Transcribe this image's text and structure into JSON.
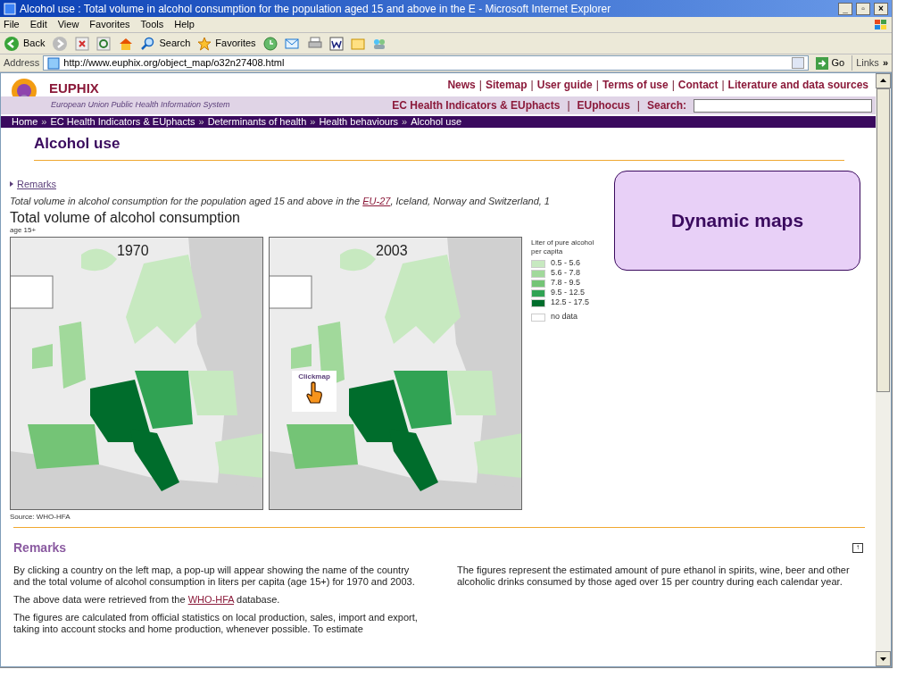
{
  "window": {
    "title": "Alcohol use : Total volume in alcohol consumption for the population aged 15 and above in the E - Microsoft Internet Explorer",
    "controls": [
      "_",
      "▫",
      "×"
    ]
  },
  "menu": [
    "File",
    "Edit",
    "View",
    "Favorites",
    "Tools",
    "Help"
  ],
  "toolbar": {
    "back": "Back",
    "search": "Search",
    "favorites": "Favorites"
  },
  "address_bar": {
    "label": "Address",
    "url": "http://www.euphix.org/object_map/o32n27408.html",
    "go": "Go",
    "links": "Links",
    "more": "»"
  },
  "site": {
    "name": "EUPHIX",
    "tagline": "European Union Public Health Information System",
    "top_links": [
      {
        "kind": "link",
        "text": "News"
      },
      {
        "kind": "separator",
        "text": "|"
      },
      {
        "kind": "link",
        "text": "Sitemap"
      },
      {
        "kind": "separator",
        "text": "|"
      },
      {
        "kind": "link",
        "text": "User guide"
      },
      {
        "kind": "separator",
        "text": "|"
      },
      {
        "kind": "link",
        "text": "Terms of use"
      },
      {
        "kind": "separator",
        "text": "|"
      },
      {
        "kind": "link",
        "text": "Contact"
      },
      {
        "kind": "separator",
        "text": "|"
      },
      {
        "kind": "link",
        "text": "Literature and data sources"
      }
    ],
    "nav_links": [
      {
        "kind": "link",
        "text": "EC Health Indicators & EUphacts"
      },
      {
        "kind": "separator",
        "text": "|"
      },
      {
        "kind": "link",
        "text": "EUphocus"
      },
      {
        "kind": "separator",
        "text": "|"
      }
    ],
    "search_label": "Search:",
    "breadcrumb": [
      {
        "kind": "link",
        "text": "Home"
      },
      {
        "kind": "separator",
        "text": "»"
      },
      {
        "kind": "link",
        "text": "EC Health Indicators & EUphacts"
      },
      {
        "kind": "separator",
        "text": "»"
      },
      {
        "kind": "link",
        "text": "Determinants of health"
      },
      {
        "kind": "separator",
        "text": "»"
      },
      {
        "kind": "link",
        "text": "Health behaviours"
      },
      {
        "kind": "separator",
        "text": "»"
      },
      {
        "kind": "link",
        "text": "Alcohol use"
      }
    ]
  },
  "page": {
    "title": "Alcohol use",
    "remarks_link": "Remarks",
    "intro_before": "Total volume in alcohol consumption for the population aged 15 and above in the ",
    "intro_link": "EU-27",
    "intro_after": ", Iceland, Norway and Switzerland, 1",
    "figure_title": "Total volume of alcohol consumption",
    "figure_subtitle": "age 15+",
    "maps": [
      {
        "year": "1970",
        "clickmap": false
      },
      {
        "year": "2003",
        "clickmap": true
      }
    ],
    "clickmap_label": "Clickmap",
    "legend": {
      "title": "Liter of pure alcohol per capita",
      "items": [
        {
          "label": "0.5 - 5.6",
          "color": "#c7e9c0"
        },
        {
          "label": "5.6 - 7.8",
          "color": "#a1d99b"
        },
        {
          "label": "7.8 - 9.5",
          "color": "#74c476"
        },
        {
          "label": "9.5 - 12.5",
          "color": "#31a354"
        },
        {
          "label": "12.5 - 17.5",
          "color": "#006d2c"
        },
        {
          "label": "no data",
          "color": "#ffffff"
        }
      ]
    },
    "source": "Source: WHO-HFA",
    "callout": "Dynamic maps"
  },
  "remarks": {
    "heading": "Remarks",
    "top_button": "↑",
    "left": [
      {
        "text": "By clicking a country on the left map, a pop-up will appear showing the name of the country and the total volume of alcohol consumption in liters per capita (age 15+) for 1970 and 2003."
      },
      {
        "before": "The above data were retrieved from the ",
        "link": "WHO-HFA",
        "after": " database."
      },
      {
        "text": "The figures are calculated from official statistics on local production, sales, import and export, taking into account stocks and home production, whenever possible. To estimate"
      }
    ],
    "right": [
      {
        "text": "The figures represent the estimated amount of pure ethanol in spirits, wine, beer and other alcoholic drinks consumed by those aged over 15 per country during each calendar year."
      }
    ]
  }
}
